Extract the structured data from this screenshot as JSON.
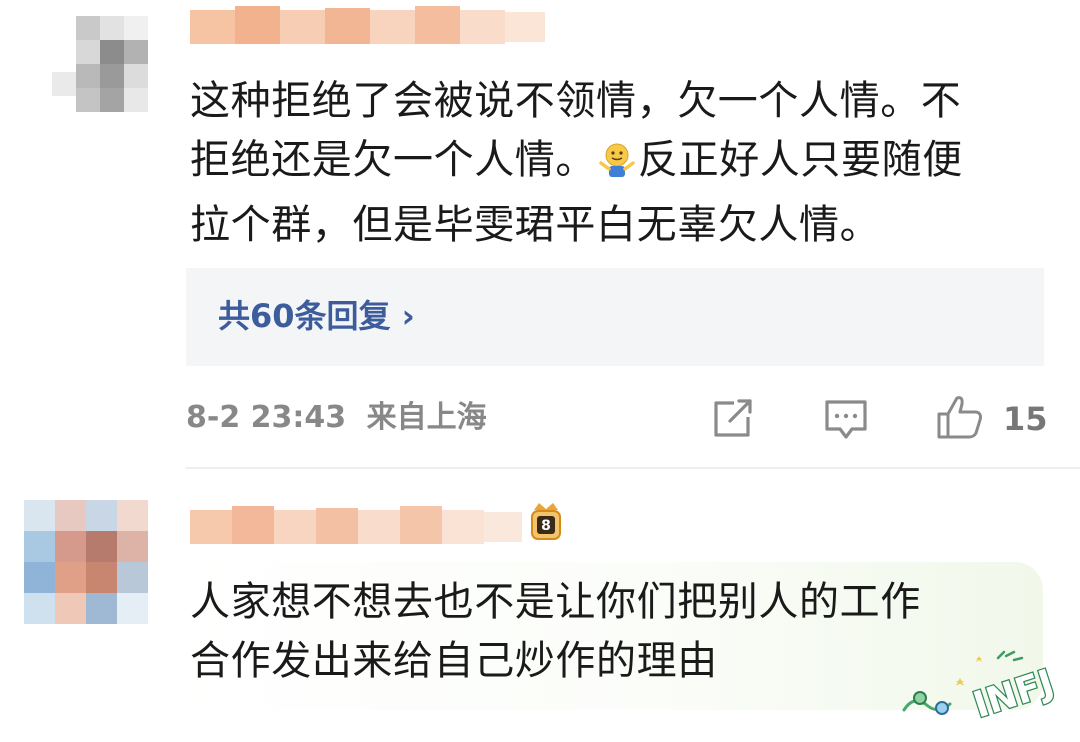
{
  "comments": [
    {
      "username_hidden": true,
      "text": "这种拒绝了会被说不领情，欠一个人情。不拒绝还是欠一个人情。🤷反正好人只要随便拉个群，但是毕雯珺平白无辜欠人情。",
      "lines": [
        "这种拒绝了会被说不领情，欠一个人情。不",
        "拒绝还是欠一个人情。",
        "反正好人只要随便",
        "拉个群，但是毕雯珺平白无辜欠人情。"
      ],
      "replies_link": "共60条回复 ›",
      "timestamp": "8-2 23:43",
      "location": "来自上海",
      "likes": "15"
    },
    {
      "username_hidden": true,
      "level_badge": "8",
      "lines": [
        "人家想不想去也不是让你们把别人的工作",
        "合作发出来给自己炒作的理由"
      ],
      "sticker_text": "INFJ"
    }
  ],
  "icons": {
    "shrug": "person-shrugging-emoji",
    "share": "share-icon",
    "comment": "comment-icon",
    "like": "thumbs-up-icon",
    "badge": "crown-level-badge-icon"
  },
  "colors": {
    "link": "#3d5c9c",
    "meta": "#888888",
    "reply_bg": "#f4f5f7",
    "bubble_tint": "#f1f8ea"
  }
}
